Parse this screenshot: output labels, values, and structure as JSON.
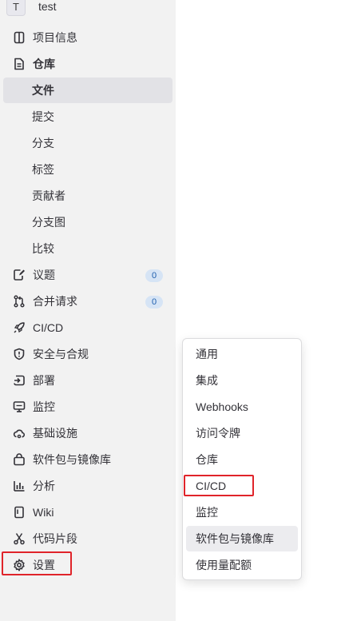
{
  "project": {
    "avatar_letter": "T",
    "name": "test"
  },
  "nav": {
    "project_info": "项目信息",
    "repository": "仓库",
    "repo_sub": [
      "文件",
      "提交",
      "分支",
      "标签",
      "贡献者",
      "分支图",
      "比较"
    ],
    "issues": "议题",
    "issues_count": "0",
    "merge_requests": "合并请求",
    "merge_requests_count": "0",
    "cicd": "CI/CD",
    "security": "安全与合规",
    "deployments": "部署",
    "monitor": "监控",
    "infrastructure": "基础设施",
    "packages": "软件包与镜像库",
    "analytics": "分析",
    "wiki": "Wiki",
    "snippets": "代码片段",
    "settings": "设置"
  },
  "settings_flyout": {
    "items": [
      "通用",
      "集成",
      "Webhooks",
      "访问令牌",
      "仓库",
      "CI/CD",
      "监控",
      "软件包与镜像库",
      "使用量配额"
    ]
  },
  "colors": {
    "highlight": "#e0242a",
    "badge_bg": "#d6e4f5",
    "badge_text": "#1f5fae",
    "sidebar_bg": "#f2f2f2"
  }
}
